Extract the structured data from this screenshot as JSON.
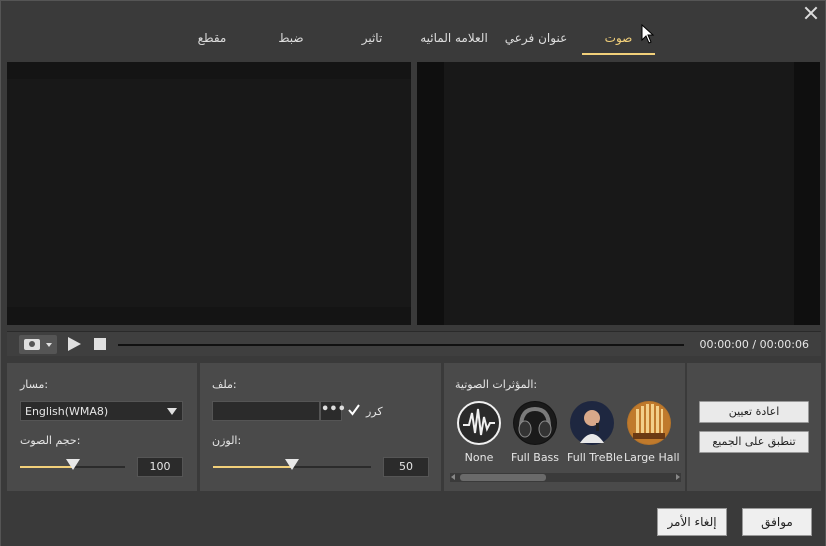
{
  "tabs": [
    {
      "label": "مقطع",
      "active": false
    },
    {
      "label": "ضبط",
      "active": false
    },
    {
      "label": "تاثير",
      "active": false
    },
    {
      "label": "العلامه المائيه",
      "active": false
    },
    {
      "label": "عنوان فرعي",
      "active": false
    },
    {
      "label": "صوت",
      "active": true
    }
  ],
  "player": {
    "time": "00:00:00 / 00:00:06",
    "progress": 0
  },
  "track_panel": {
    "track_label": "مسار:",
    "track_value": "English(WMA8)",
    "volume_label": "حجم الصوت:",
    "volume_value": "100",
    "volume_level": 0.5
  },
  "file_panel": {
    "file_label": "ملف:",
    "loop_label": "كرر",
    "loop_checked": true,
    "dots_label": "•••",
    "weight_label": "الوزن:",
    "weight_value": "50",
    "weight_level": 0.5
  },
  "effects_panel": {
    "title": "المؤثرات الصوتية:",
    "effects": [
      {
        "label": "None",
        "icon": "waveform-icon"
      },
      {
        "label": "Full Bass",
        "icon": "headphones-icon"
      },
      {
        "label": "Full TreBle",
        "icon": "singer-icon"
      },
      {
        "label": "Large Hall",
        "icon": "organ-hall-icon"
      }
    ]
  },
  "actions": {
    "reset_label": "اعادة تعيين",
    "apply_all_label": "تنطبق على الجميع"
  },
  "footer": {
    "ok_label": "موافق",
    "cancel_label": "إلغاء الأمر"
  },
  "colors": {
    "accent": "#f2d07a",
    "background": "#3a3a3a",
    "panel": "#4a4a4a"
  }
}
